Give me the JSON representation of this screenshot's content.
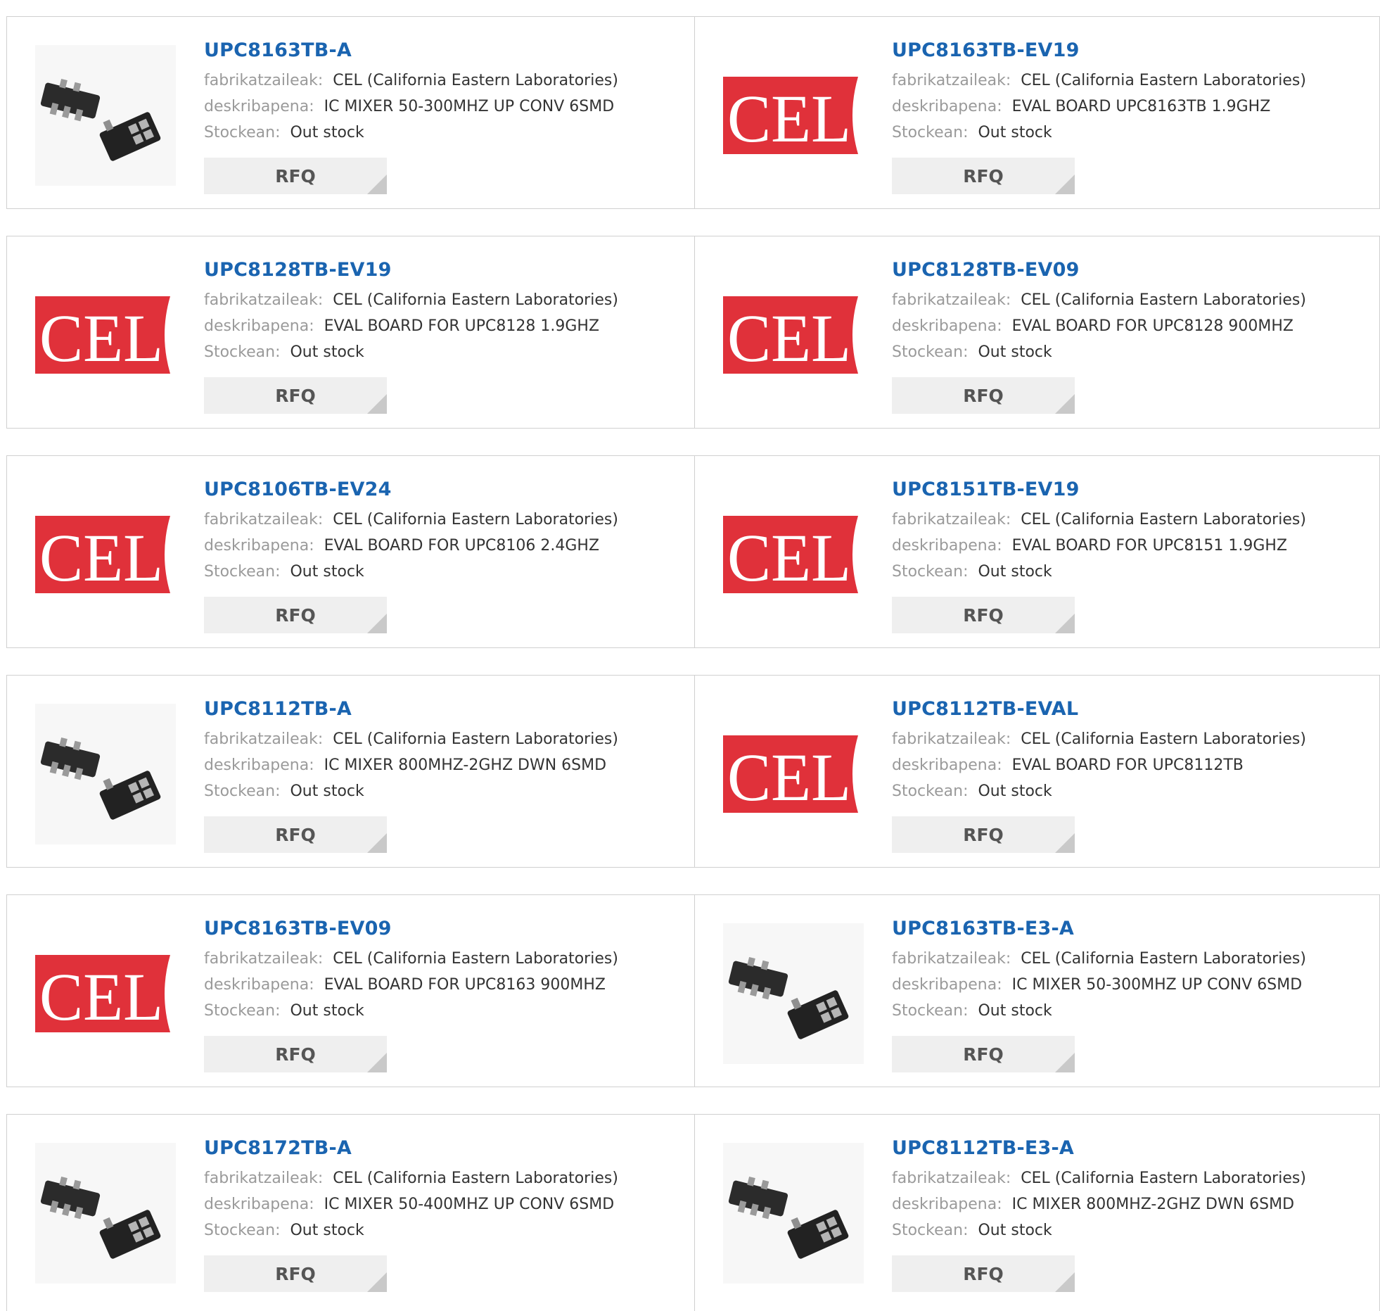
{
  "labels": {
    "manufacturer": "fabrikatzaileak:",
    "description": "deskribapena:",
    "stock": "Stockean:"
  },
  "rfq_label": "RFQ",
  "colors": {
    "title": "#1a64b0",
    "cel_red": "#e0313a",
    "rfq_bg": "#efefef"
  },
  "products": [
    {
      "part": "UPC8163TB-A",
      "manufacturer": "CEL (California Eastern Laboratories)",
      "description": "IC MIXER 50-300MHZ UP CONV 6SMD",
      "stock": "Out stock",
      "image": "chip-icon"
    },
    {
      "part": "UPC8163TB-EV19",
      "manufacturer": "CEL (California Eastern Laboratories)",
      "description": "EVAL BOARD UPC8163TB 1.9GHZ",
      "stock": "Out stock",
      "image": "cel-logo"
    },
    {
      "part": "UPC8128TB-EV19",
      "manufacturer": "CEL (California Eastern Laboratories)",
      "description": "EVAL BOARD FOR UPC8128 1.9GHZ",
      "stock": "Out stock",
      "image": "cel-logo"
    },
    {
      "part": "UPC8128TB-EV09",
      "manufacturer": "CEL (California Eastern Laboratories)",
      "description": "EVAL BOARD FOR UPC8128 900MHZ",
      "stock": "Out stock",
      "image": "cel-logo"
    },
    {
      "part": "UPC8106TB-EV24",
      "manufacturer": "CEL (California Eastern Laboratories)",
      "description": "EVAL BOARD FOR UPC8106 2.4GHZ",
      "stock": "Out stock",
      "image": "cel-logo"
    },
    {
      "part": "UPC8151TB-EV19",
      "manufacturer": "CEL (California Eastern Laboratories)",
      "description": "EVAL BOARD FOR UPC8151 1.9GHZ",
      "stock": "Out stock",
      "image": "cel-logo"
    },
    {
      "part": "UPC8112TB-A",
      "manufacturer": "CEL (California Eastern Laboratories)",
      "description": "IC MIXER 800MHZ-2GHZ DWN 6SMD",
      "stock": "Out stock",
      "image": "chip-icon"
    },
    {
      "part": "UPC8112TB-EVAL",
      "manufacturer": "CEL (California Eastern Laboratories)",
      "description": "EVAL BOARD FOR UPC8112TB",
      "stock": "Out stock",
      "image": "cel-logo"
    },
    {
      "part": "UPC8163TB-EV09",
      "manufacturer": "CEL (California Eastern Laboratories)",
      "description": "EVAL BOARD FOR UPC8163 900MHZ",
      "stock": "Out stock",
      "image": "cel-logo"
    },
    {
      "part": "UPC8163TB-E3-A",
      "manufacturer": "CEL (California Eastern Laboratories)",
      "description": "IC MIXER 50-300MHZ UP CONV 6SMD",
      "stock": "Out stock",
      "image": "chip-icon"
    },
    {
      "part": "UPC8172TB-A",
      "manufacturer": "CEL (California Eastern Laboratories)",
      "description": "IC MIXER 50-400MHZ UP CONV 6SMD",
      "stock": "Out stock",
      "image": "chip-icon"
    },
    {
      "part": "UPC8112TB-E3-A",
      "manufacturer": "CEL (California Eastern Laboratories)",
      "description": "IC MIXER 800MHZ-2GHZ DWN 6SMD",
      "stock": "Out stock",
      "image": "chip-icon"
    }
  ]
}
